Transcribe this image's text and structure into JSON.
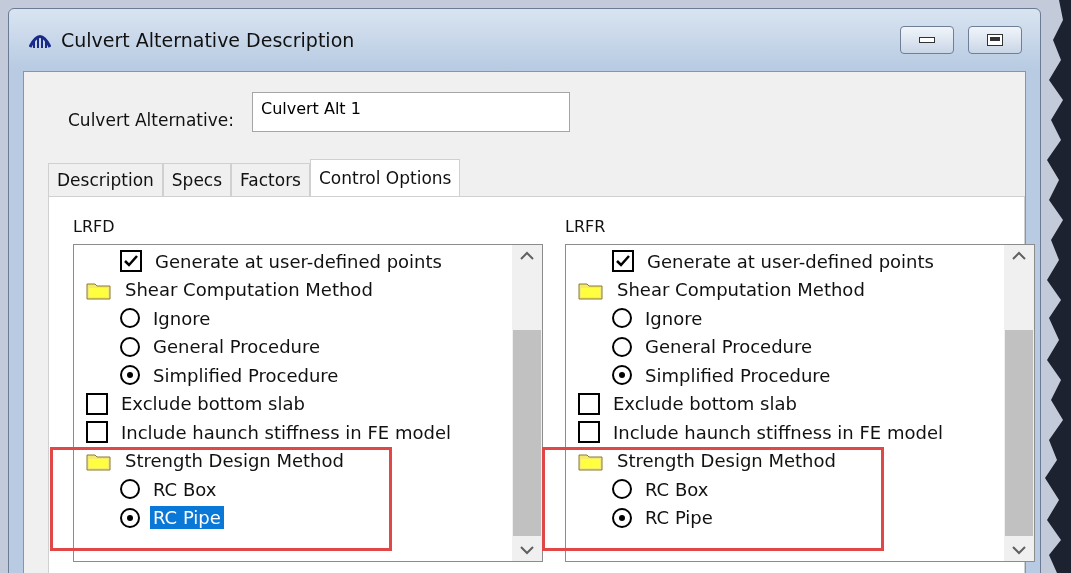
{
  "window": {
    "title": "Culvert Alternative Description"
  },
  "culvert_alternative": {
    "label": "Culvert Alternative:",
    "value": "Culvert Alt 1"
  },
  "tabs": [
    {
      "label": "Description",
      "selected": false
    },
    {
      "label": "Specs",
      "selected": false
    },
    {
      "label": "Factors",
      "selected": false
    },
    {
      "label": "Control Options",
      "selected": true
    }
  ],
  "panels": [
    {
      "title": "LRFD",
      "items": [
        {
          "children": [
            {
              "kind": "checkbox",
              "label": "Generate at user-defined points",
              "checked": true,
              "selected": false
            }
          ]
        },
        {
          "kind": "folder",
          "label": "Shear Computation Method",
          "annotated": false,
          "selected": false,
          "children": [
            {
              "kind": "radio",
              "label": "Ignore",
              "checked": false,
              "selected": false
            },
            {
              "kind": "radio",
              "label": "General Procedure",
              "checked": false,
              "selected": false
            },
            {
              "kind": "radio",
              "label": "Simplified Procedure",
              "checked": true,
              "selected": false
            }
          ]
        },
        {
          "kind": "checkbox",
          "label": "Exclude bottom slab",
          "checked": false,
          "selected": false
        },
        {
          "kind": "checkbox",
          "label": "Include haunch stiffness in FE model",
          "checked": false,
          "selected": false
        },
        {
          "kind": "folder",
          "label": "Strength Design Method",
          "annotated": true,
          "selected": false,
          "children": [
            {
              "kind": "radio",
              "label": "RC Box",
              "checked": false,
              "selected": false
            },
            {
              "kind": "radio",
              "label": "RC Pipe",
              "checked": true,
              "selected": true
            }
          ]
        }
      ]
    },
    {
      "title": "LRFR",
      "items": [
        {
          "children": [
            {
              "kind": "checkbox",
              "label": "Generate at user-defined points",
              "checked": true,
              "selected": false
            }
          ]
        },
        {
          "kind": "folder",
          "label": "Shear Computation Method",
          "annotated": false,
          "selected": false,
          "children": [
            {
              "kind": "radio",
              "label": "Ignore",
              "checked": false,
              "selected": false
            },
            {
              "kind": "radio",
              "label": "General Procedure",
              "checked": false,
              "selected": false
            },
            {
              "kind": "radio",
              "label": "Simplified Procedure",
              "checked": true,
              "selected": false
            }
          ]
        },
        {
          "kind": "checkbox",
          "label": "Exclude bottom slab",
          "checked": false,
          "selected": false
        },
        {
          "kind": "checkbox",
          "label": "Include haunch stiffness in FE model",
          "checked": false,
          "selected": false
        },
        {
          "kind": "folder",
          "label": "Strength Design Method",
          "annotated": true,
          "selected": false,
          "children": [
            {
              "kind": "radio",
              "label": "RC Box",
              "checked": false,
              "selected": false
            },
            {
              "kind": "radio",
              "label": "RC Pipe",
              "checked": true,
              "selected": false
            }
          ]
        }
      ]
    }
  ]
}
